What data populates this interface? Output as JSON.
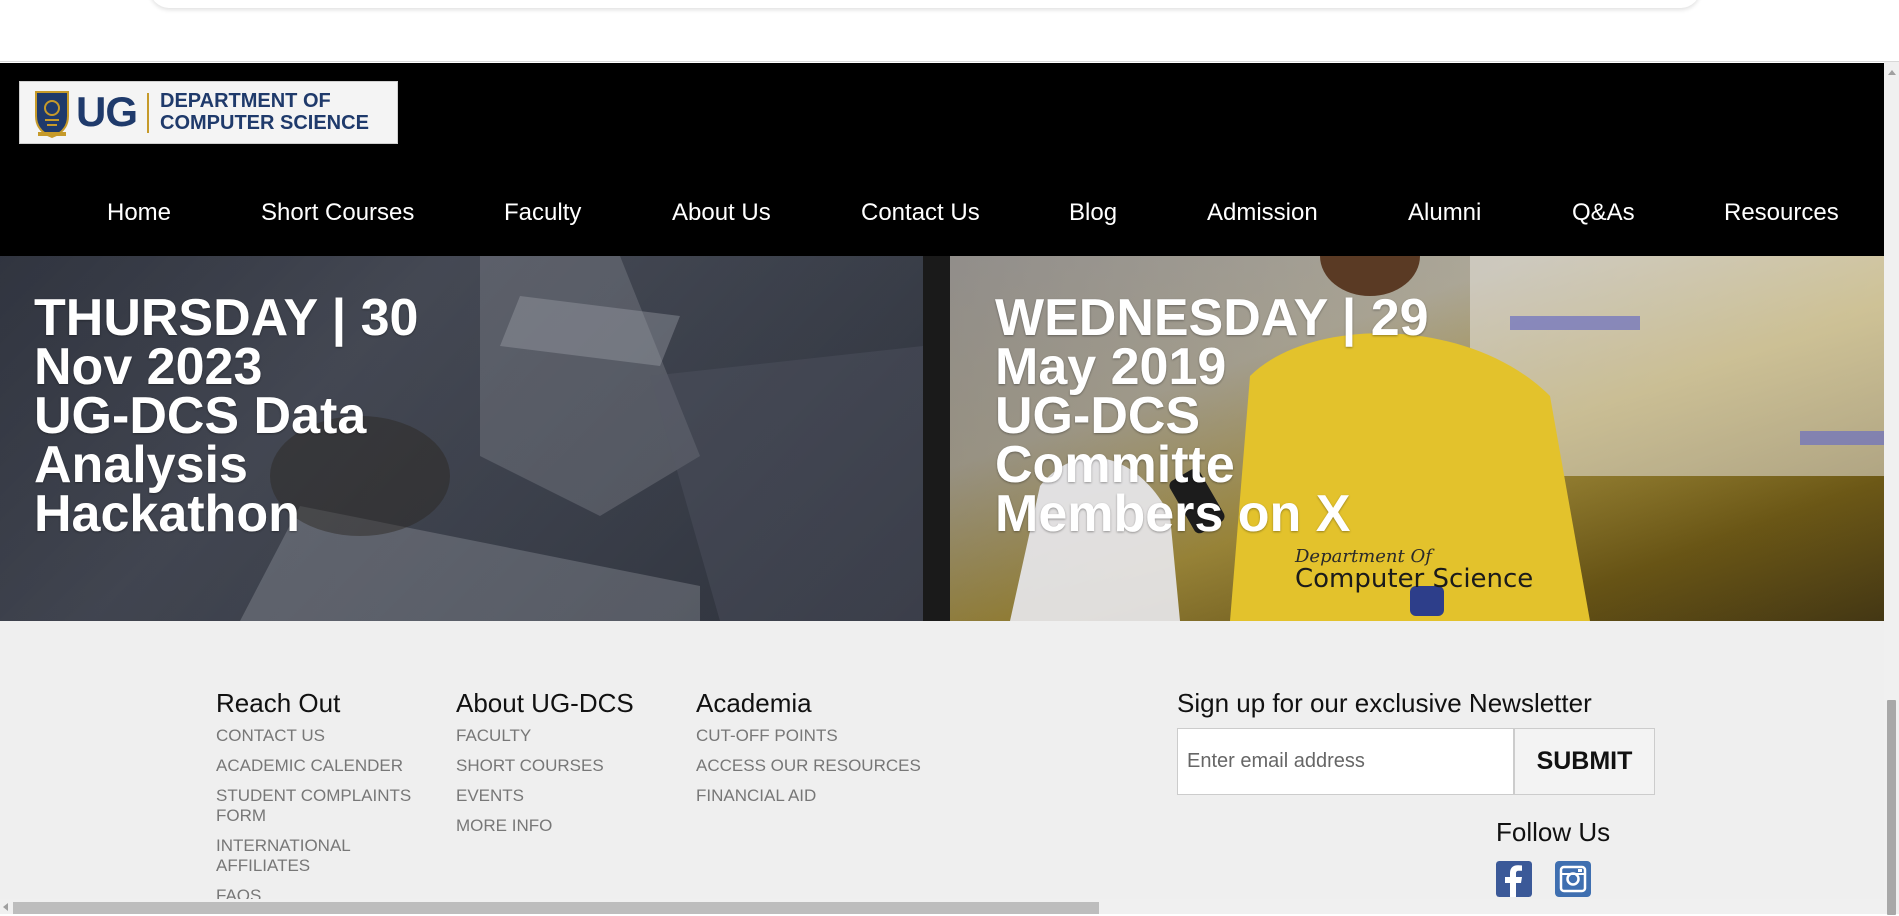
{
  "logo": {
    "short": "UG",
    "line1": "DEPARTMENT OF",
    "line2": "COMPUTER SCIENCE"
  },
  "nav": {
    "items": [
      {
        "label": "Home"
      },
      {
        "label": "Short Courses"
      },
      {
        "label": "Faculty"
      },
      {
        "label": "About Us"
      },
      {
        "label": "Contact Us"
      },
      {
        "label": "Blog"
      },
      {
        "label": "Admission"
      },
      {
        "label": "Alumni"
      },
      {
        "label": "Q&As"
      },
      {
        "label": "Resources"
      }
    ]
  },
  "hero": {
    "left": {
      "line1": "THURSDAY | 30",
      "line2": "Nov 2023",
      "line3": "UG-DCS Data",
      "line4": "Analysis",
      "line5": "Hackathon"
    },
    "right": {
      "line1": "WEDNESDAY | 29",
      "line2": "May 2019",
      "line3": "UG-DCS",
      "line4": "Committe",
      "line5": "Members on X",
      "shirt_text_1": "Department Of",
      "shirt_text_2": "Computer Science"
    }
  },
  "footer": {
    "reach_out": {
      "title": "Reach Out",
      "links": [
        "CONTACT US",
        "ACADEMIC CALENDER",
        "STUDENT COMPLAINTS FORM",
        "INTERNATIONAL AFFILIATES",
        "FAQS"
      ]
    },
    "about": {
      "title": "About UG-DCS",
      "links": [
        "FACULTY",
        "SHORT COURSES",
        "EVENTS",
        "MORE INFO"
      ]
    },
    "academia": {
      "title": "Academia",
      "links": [
        "CUT-OFF POINTS",
        "ACCESS OUR RESOURCES",
        "FINANCIAL AID"
      ]
    },
    "newsletter": {
      "title": "Sign up for our exclusive Newsletter",
      "placeholder": "Enter email address",
      "submit": "SUBMIT"
    },
    "follow": {
      "title": "Follow Us",
      "icons": [
        "facebook-icon",
        "instagram-icon"
      ]
    }
  },
  "colors": {
    "header_bg": "#000000",
    "brand_navy": "#1f3a6b",
    "brand_gold": "#c69a2a",
    "footer_bg": "#efefef",
    "facebook_blue": "#3b5998",
    "instagram_blue": "#3f6fb0"
  }
}
